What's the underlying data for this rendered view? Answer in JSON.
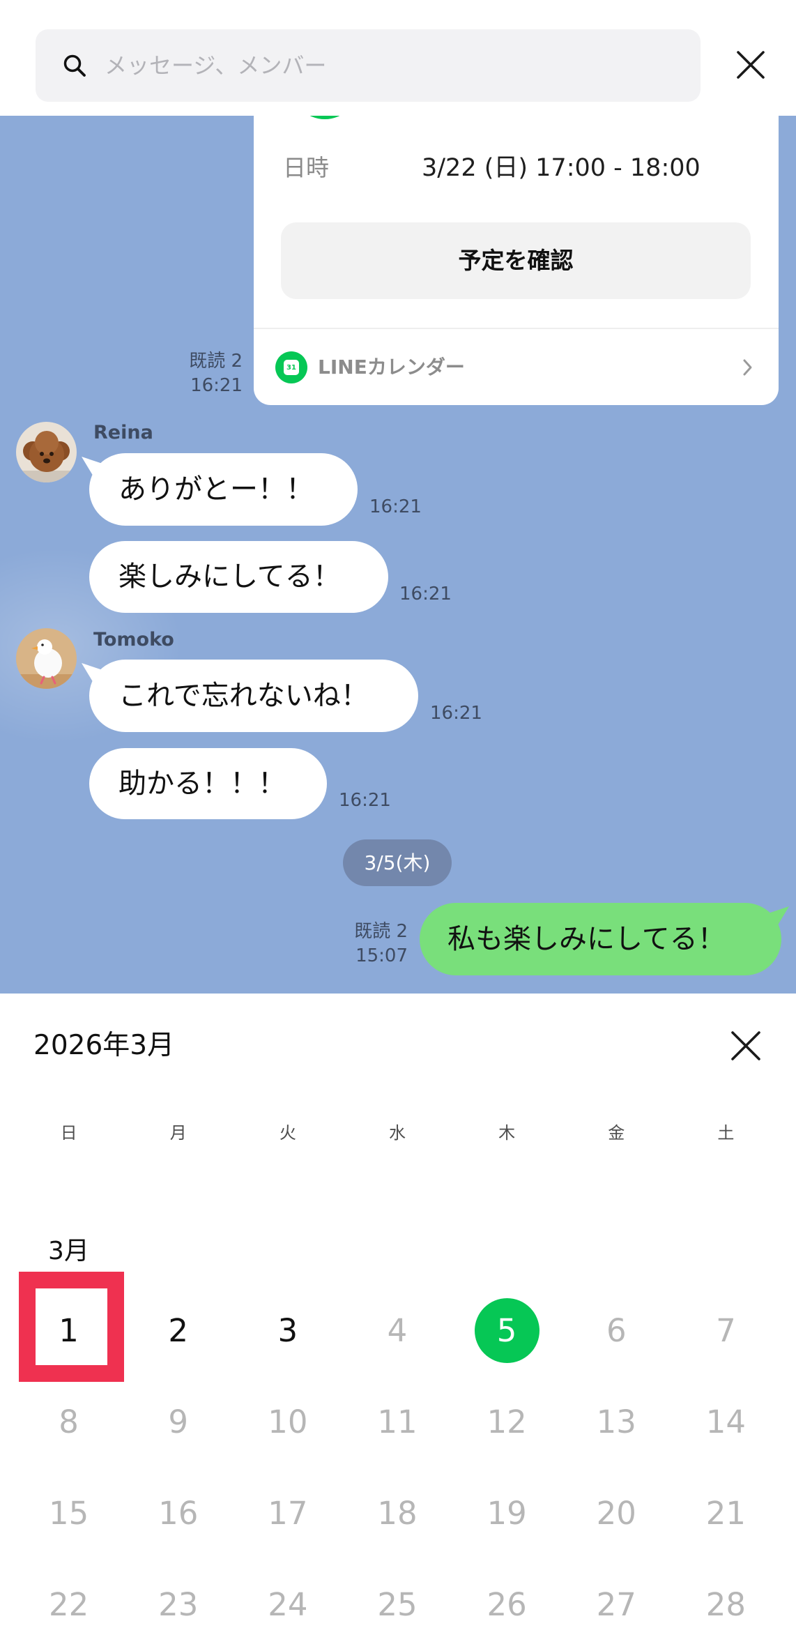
{
  "search": {
    "placeholder": "メッセージ、メンバー"
  },
  "icons": {
    "search": "search-icon",
    "close": "close-icon",
    "event": "event-icon",
    "line_calendar": "line-calendar-icon",
    "chevron": "chevron-right-icon"
  },
  "colors": {
    "chat_background": "#8CAAD8",
    "own_bubble": "#79DF7B",
    "line_green": "#06C755",
    "highlight": "#EF3150"
  },
  "chat": {
    "event_card": {
      "datetime_label": "日時",
      "datetime_value": "3/22 (日) 17:00 - 18:00",
      "confirm_button": "予定を確認",
      "footer_icon_text": "31",
      "footer_label": "LINEカレンダー",
      "read_status": "既読 2",
      "time": "16:21"
    },
    "groups": [
      {
        "sender": "Reina",
        "bubbles": [
          {
            "text": "ありがとー！！",
            "time": "16:21"
          },
          {
            "text": "楽しみにしてる！",
            "time": "16:21"
          }
        ]
      },
      {
        "sender": "Tomoko",
        "bubbles": [
          {
            "text": "これで忘れないね！",
            "time": "16:21"
          },
          {
            "text": "助かる！！！",
            "time": "16:21"
          }
        ]
      }
    ],
    "date_separator": "3/5(木)",
    "own_message": {
      "text": "私も楽しみにしてる！",
      "read_status": "既読 2",
      "time": "15:07"
    }
  },
  "calendar": {
    "title": "2026年3月",
    "weekdays": [
      "日",
      "月",
      "火",
      "水",
      "木",
      "金",
      "土"
    ],
    "month_label": "3月",
    "weeks": [
      [
        1,
        2,
        3,
        4,
        5,
        6,
        7
      ],
      [
        8,
        9,
        10,
        11,
        12,
        13,
        14
      ],
      [
        15,
        16,
        17,
        18,
        19,
        20,
        21
      ],
      [
        22,
        23,
        24,
        25,
        26,
        27,
        28
      ]
    ],
    "enabled_days": [
      1,
      2,
      3,
      5
    ],
    "today": 5,
    "highlighted_day": 1
  }
}
